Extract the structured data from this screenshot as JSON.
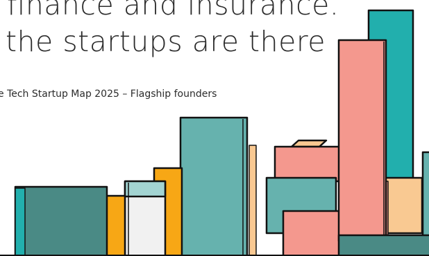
{
  "headline": {
    "line_1": "finance and insurance.",
    "line_2": "the startups are there"
  },
  "caption": "e Tech Startup Map 2025 – Flagship founders",
  "palette": {
    "teal_dark": "#4a8a85",
    "teal_mid": "#66b2ae",
    "teal_light": "#a3d4d2",
    "teal_bright": "#22afad",
    "orange": "#f7a715",
    "peach": "#f9c992",
    "salmon": "#f4988e",
    "pale_grey": "#f1f1f1",
    "outline": "#111111"
  },
  "illustration": {
    "icon": "city-skyline-illustration"
  }
}
